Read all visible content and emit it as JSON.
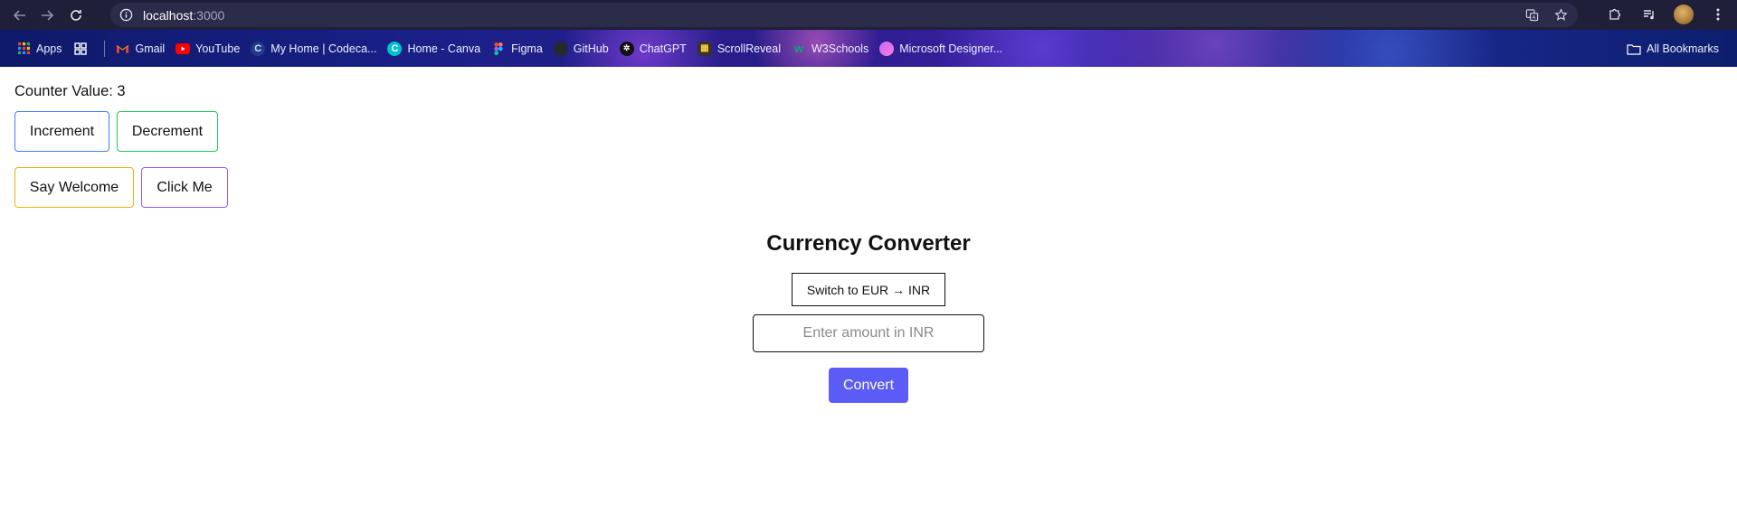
{
  "browser": {
    "url_host": "localhost",
    "url_port": ":3000",
    "bookmarks": [
      {
        "label": "Apps",
        "icon": "apps-grid-icon",
        "color": "#ea4335"
      },
      {
        "label": "",
        "icon": "extensions-grid-icon",
        "color": "#ffffff"
      },
      {
        "label": "Gmail",
        "icon": "gmail-icon",
        "color": "#ea4335"
      },
      {
        "label": "YouTube",
        "icon": "youtube-icon",
        "color": "#ff0000"
      },
      {
        "label": "My Home | Codeca...",
        "icon": "codecademy-icon",
        "color": "#1f3b88"
      },
      {
        "label": "Home - Canva",
        "icon": "canva-icon",
        "color": "#00c4cc"
      },
      {
        "label": "Figma",
        "icon": "figma-icon",
        "color": "#f24e1e"
      },
      {
        "label": "GitHub",
        "icon": "github-icon",
        "color": "#24292e"
      },
      {
        "label": "ChatGPT",
        "icon": "chatgpt-icon",
        "color": "#111111"
      },
      {
        "label": "ScrollReveal",
        "icon": "scrollreveal-icon",
        "color": "#333333"
      },
      {
        "label": "W3Schools",
        "icon": "w3schools-icon",
        "color": "#04aa6d"
      },
      {
        "label": "Microsoft Designer...",
        "icon": "designer-icon",
        "color": "#c36bff"
      }
    ],
    "all_bookmarks": "All Bookmarks"
  },
  "counter": {
    "label": "Counter Value: 3"
  },
  "buttons": {
    "increment": "Increment",
    "decrement": "Decrement",
    "say_welcome": "Say Welcome",
    "click_me": "Click Me"
  },
  "converter": {
    "title": "Currency Converter",
    "switch_label": "Switch to EUR → INR",
    "input_placeholder": "Enter amount in INR",
    "convert_label": "Convert",
    "accent_color": "#5b5bf6"
  }
}
